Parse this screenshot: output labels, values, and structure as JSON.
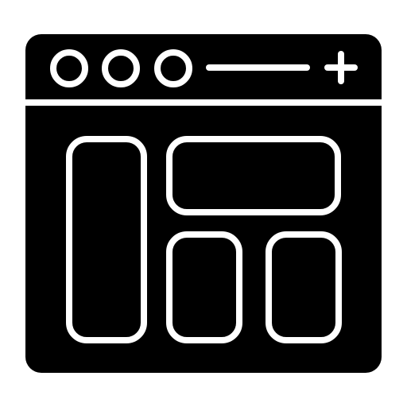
{
  "icon": {
    "name": "browser-dashboard-layout-icon",
    "colors": {
      "background": "#ffffff",
      "fill": "#000000",
      "stroke": "#ffffff"
    },
    "elements": {
      "window_controls": [
        "window-control-dot-1-icon",
        "window-control-dot-2-icon",
        "window-control-dot-3-icon"
      ],
      "address_bar": "address-bar-line-icon",
      "new_tab": "new-tab-plus-icon",
      "layout_panels": [
        "left-sidebar-panel",
        "top-wide-panel",
        "bottom-middle-panel",
        "bottom-right-panel"
      ]
    }
  }
}
